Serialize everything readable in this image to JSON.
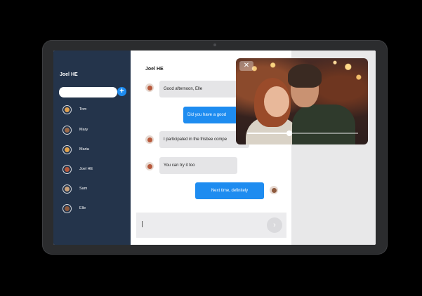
{
  "sidebar": {
    "title": "Joel HE",
    "search": {
      "value": "",
      "placeholder": ""
    },
    "add_icon": "plus-icon",
    "contacts": [
      {
        "name": "Tom",
        "avatar_color": "#e0a050"
      },
      {
        "name": "Mary",
        "avatar_color": "#9b6a4a"
      },
      {
        "name": "Maria",
        "avatar_color": "#e2a24c"
      },
      {
        "name": "Joel HE",
        "avatar_color": "#b85a3c"
      },
      {
        "name": "Sam",
        "avatar_color": "#c9a07a"
      },
      {
        "name": "Elle",
        "avatar_color": "#8e5a3e"
      }
    ]
  },
  "chat": {
    "title": "Joel HE",
    "messages": [
      {
        "direction": "incoming",
        "text": "Good afternoon, Elle"
      },
      {
        "direction": "outgoing",
        "text": "Did you have a good"
      },
      {
        "direction": "incoming",
        "text": "I participated in the frisbee compe"
      },
      {
        "direction": "incoming",
        "text": "You can try it too"
      },
      {
        "direction": "outgoing",
        "text": "Next time, definitely"
      }
    ],
    "composer": {
      "value": "",
      "placeholder": ""
    },
    "send_icon": "send-chevron-icon"
  },
  "video": {
    "close_icon": "close-icon",
    "progress": 0.38
  },
  "colors": {
    "sidebar": "#24344b",
    "accent": "#1e8cf0",
    "incoming_bubble": "#e5e5e7"
  }
}
